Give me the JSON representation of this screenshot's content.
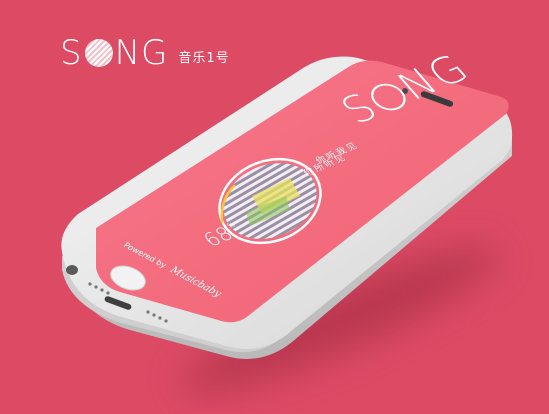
{
  "brand": {
    "wordmark_left": "S",
    "wordmark_right": "NG",
    "tagline": "音乐1号"
  },
  "screen": {
    "logo_left": "S",
    "logo_right": "NG",
    "sub_line1": "你听我见",
    "sub_line2": "你所听见",
    "percent_value": "68",
    "percent_unit": "%",
    "powered_prefix": "Powered by",
    "powered_signature": "Musicbaby"
  },
  "colors": {
    "background": "#dc4a64",
    "screen": "#f36b7a",
    "phone_body": "#ececec",
    "accent_white": "#ffffff"
  },
  "icons": [
    "home-button-icon",
    "speaker-grille-icon",
    "lightning-port-icon",
    "headphone-jack-icon",
    "earpiece-icon",
    "front-camera-icon",
    "striped-disc-icon"
  ]
}
